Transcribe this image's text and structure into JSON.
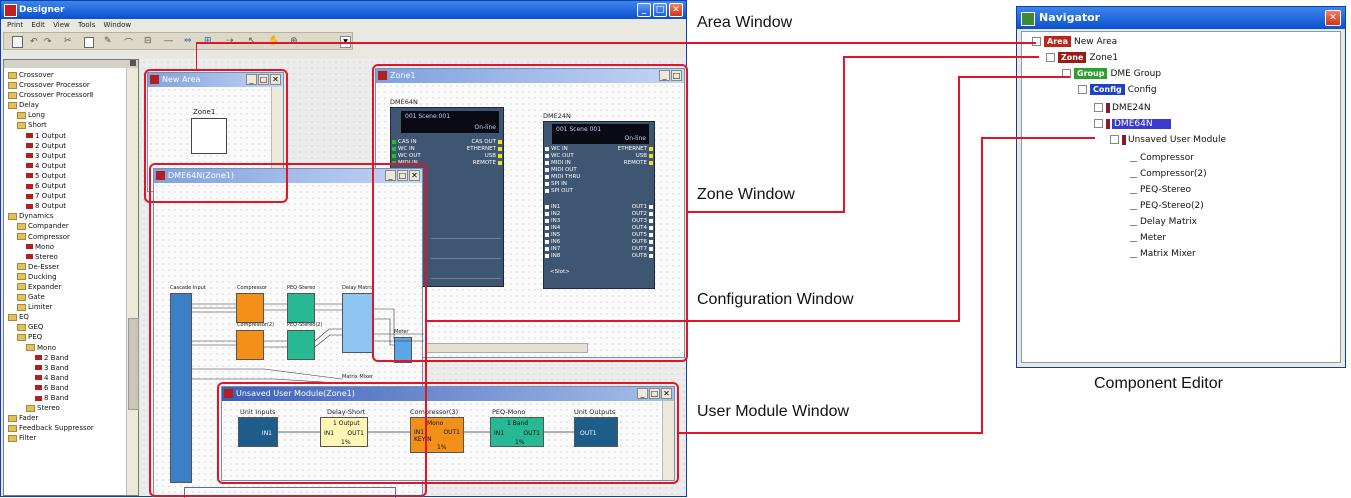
{
  "designer": {
    "title": "Designer",
    "menu": [
      "Print",
      "Edit",
      "View",
      "Tools",
      "Window"
    ],
    "tree_items": [
      "Crossover",
      "Crossover Processor",
      "Crossover ProcessorⅡ",
      "Delay",
      "Long",
      "Short",
      "1 Output",
      "2 Output",
      "3 Output",
      "4 Output",
      "5 Output",
      "6 Output",
      "7 Output",
      "8 Output",
      "Dynamics",
      "Compander",
      "Compressor",
      "Mono",
      "Stereo",
      "De-Esser",
      "Ducking",
      "Expander",
      "Gate",
      "Limiter",
      "EQ",
      "GEQ",
      "PEQ",
      "Mono",
      "2 Band",
      "3 Band",
      "4 Band",
      "6 Band",
      "8 Band",
      "Stereo",
      "Fader",
      "Feedback Suppressor",
      "Filter"
    ]
  },
  "area_window": {
    "title": "New Area",
    "zone_label": "Zone1"
  },
  "zone_window": {
    "title": "Zone1",
    "dme64n": {
      "name": "DME64N",
      "scene": "001 Scene 001",
      "status": "On-line",
      "left_ports": [
        "CAS IN",
        "WC IN",
        "WC OUT",
        "MIDI IN"
      ],
      "right_ports": [
        "CAS OUT",
        "ETHERNET",
        "USB",
        "REMOTE"
      ]
    },
    "dme24n": {
      "name": "DME24N",
      "scene": "001 Scene 001",
      "status": "On-line",
      "left_ports": [
        "WC IN",
        "WC OUT",
        "MIDI IN",
        "MIDI OUT",
        "MIDI THRU",
        "SPI IN",
        "SPI OUT"
      ],
      "right_ports": [
        "ETHERNET",
        "USB",
        "REMOTE"
      ],
      "inputs": [
        "IN1",
        "IN2",
        "IN3",
        "IN4",
        "IN5",
        "IN6",
        "IN7",
        "IN8"
      ],
      "outputs": [
        "OUT1",
        "OUT2",
        "OUT3",
        "OUT4",
        "OUT5",
        "OUT6",
        "OUT7",
        "OUT8"
      ],
      "slot": "<Slot>"
    }
  },
  "config_window": {
    "title": "DME64N(Zone1)",
    "modules": [
      "Cascade Input",
      "Compressor",
      "PEQ-Stereo",
      "Compressor(2)",
      "PEQ-Stereo(2)",
      "Delay Matrix",
      "Meter",
      "Matrix Mixer"
    ]
  },
  "user_module_window": {
    "title": "Unsaved User Module(Zone1)",
    "blocks": [
      {
        "label": "Unit Inputs",
        "port": "IN1"
      },
      {
        "label": "Delay-Short",
        "head": "1 Output",
        "in": "IN1",
        "out": "OUT1",
        "value": "1%"
      },
      {
        "label": "Compressor(3)",
        "head": "Mono",
        "in": "IN1",
        "in2": "KEYIN",
        "out": "OUT1",
        "value": "1%"
      },
      {
        "label": "PEQ-Mono",
        "head": "1 Band",
        "in": "IN1",
        "out": "OUT1",
        "value": "1%"
      },
      {
        "label": "Unit Outputs",
        "port": "OUT1"
      }
    ]
  },
  "navigator": {
    "title": "Navigator",
    "items": [
      {
        "tag": "Area",
        "label": "New Area",
        "tag_color": "#c0231d"
      },
      {
        "tag": "Zone",
        "label": "Zone1",
        "tag_color": "#9a1a14"
      },
      {
        "tag": "Group",
        "label": "DME Group",
        "tag_color": "#2ca02c"
      },
      {
        "tag": "Config",
        "label": "Config",
        "tag_color": "#1f3fcf"
      },
      {
        "label": "DME24N"
      },
      {
        "label": "DME64N",
        "selected": true
      },
      {
        "label": "Unsaved User Module"
      },
      {
        "label": "Compressor"
      },
      {
        "label": "Compressor(2)"
      },
      {
        "label": "PEQ-Stereo"
      },
      {
        "label": "PEQ-Stereo(2)"
      },
      {
        "label": "Delay Matrix"
      },
      {
        "label": "Meter"
      },
      {
        "label": "Matrix Mixer"
      }
    ]
  },
  "labels": {
    "area": "Area Window",
    "zone": "Zone Window",
    "config": "Configuration Window",
    "user_module": "User Module Window",
    "component_editor": "Component Editor"
  },
  "colors": {
    "callout": "#e0152a",
    "xp_title": "#0a4fd0",
    "module_orange": "#f2901a",
    "module_green": "#28b894",
    "module_blue": "#5aa6e6",
    "dme_panel": "#3f5672"
  }
}
